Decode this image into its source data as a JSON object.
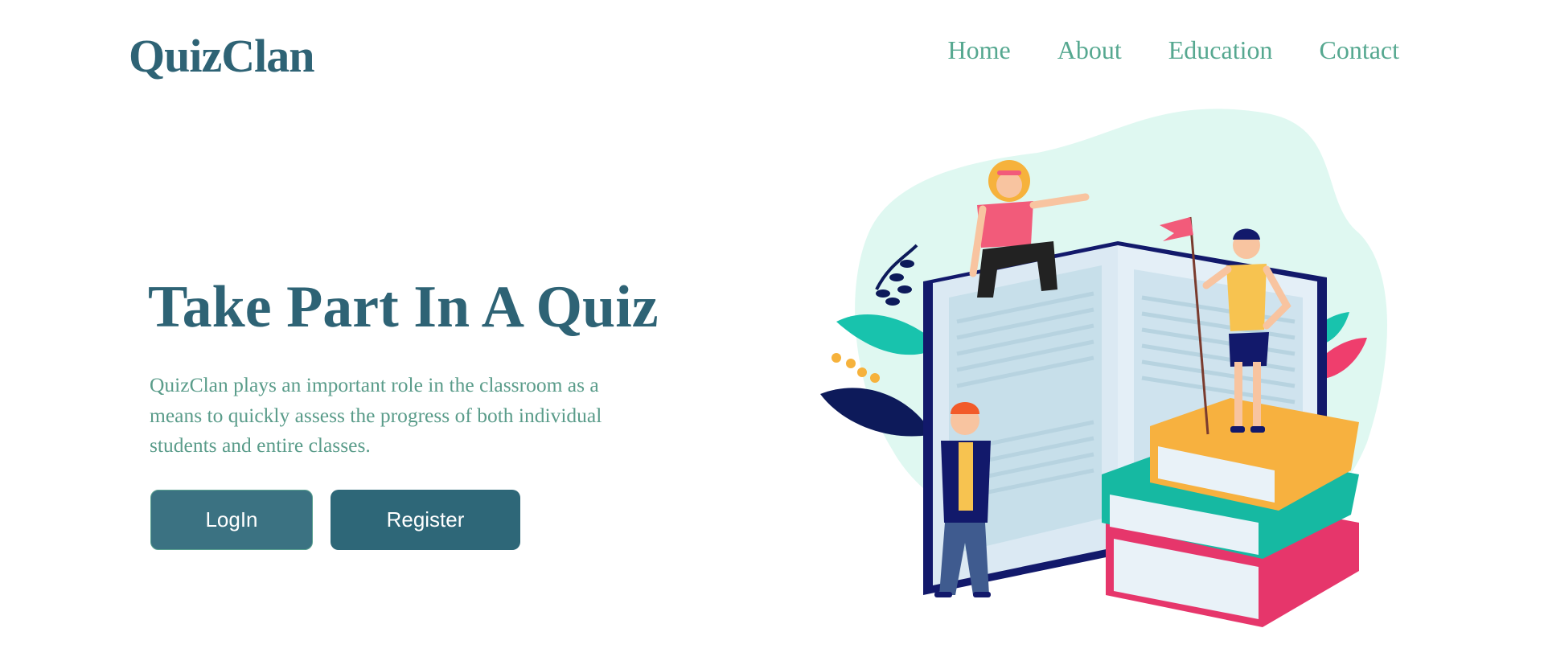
{
  "header": {
    "logo": "QuizClan",
    "nav": [
      {
        "label": "Home"
      },
      {
        "label": "About"
      },
      {
        "label": "Education"
      },
      {
        "label": "Contact"
      }
    ]
  },
  "hero": {
    "title": "Take Part In A Quiz",
    "description": "QuizClan plays an important role in the classroom as a means to quickly assess the progress of both individual students and entire classes.",
    "login_label": "LogIn",
    "register_label": "Register"
  },
  "colors": {
    "primary": "#2e6375",
    "accent": "#56a890",
    "button": "#2e6778",
    "blob": "#dff8f1"
  },
  "illustration": {
    "subject": "students with open book and stack of books"
  }
}
